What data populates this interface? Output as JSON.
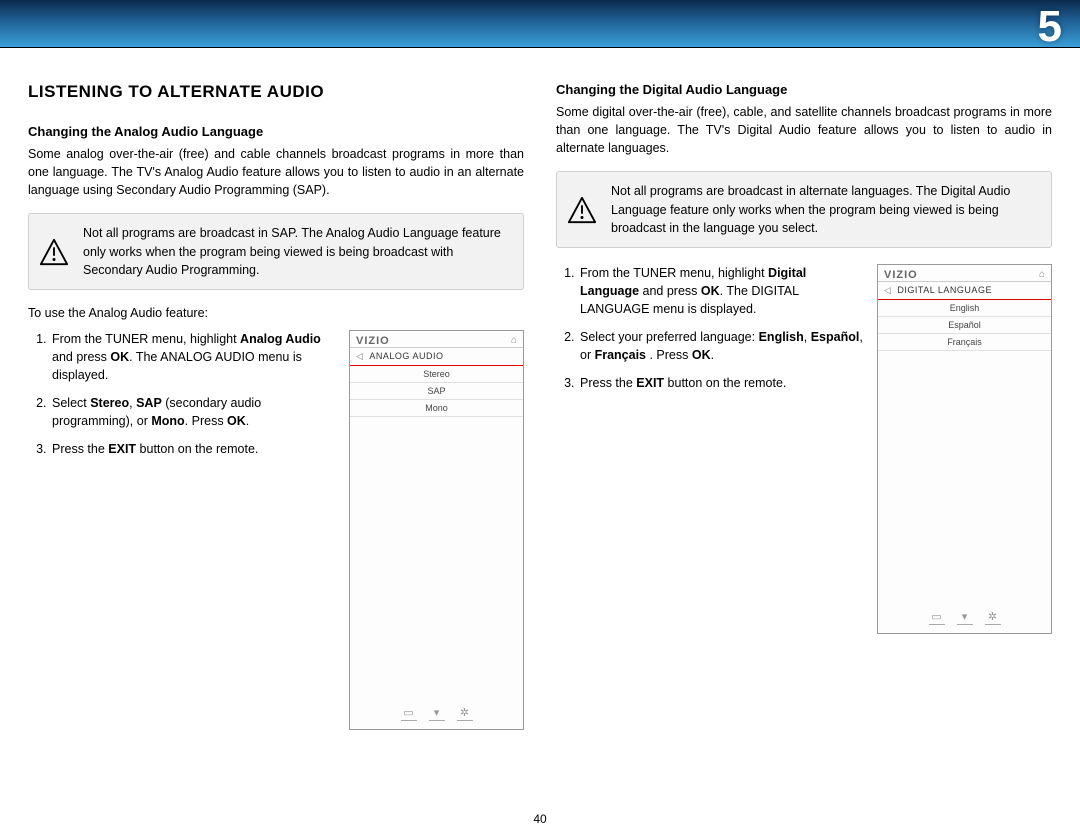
{
  "chapter": "5",
  "pageNumber": "40",
  "col1": {
    "heading": "LISTENING TO ALTERNATE AUDIO",
    "sub": "Changing the Analog Audio Language",
    "intro": "Some analog over-the-air (free) and cable channels broadcast programs in more than one language. The TV's Analog Audio feature allows you to listen to audio in an alternate language using Secondary Audio Programming (SAP).",
    "note": "Not all programs are broadcast in SAP. The Analog Audio Language feature only works when the program being viewed is being broadcast with Secondary Audio Programming.",
    "lead": "To use the Analog Audio feature:",
    "steps": {
      "s1a": "From the TUNER menu, highlight ",
      "s1b": "Analog Audio",
      "s1c": " and press ",
      "s1d": "OK",
      "s1e": ". The ANALOG AUDIO menu is displayed.",
      "s2a": "Select ",
      "s2b": "Stereo",
      "s2c": ", ",
      "s2d": "SAP",
      "s2e": " (secondary audio programming), or ",
      "s2f": "Mono",
      "s2g": ". Press ",
      "s2h": "OK",
      "s2i": ".",
      "s3a": "Press the ",
      "s3b": "EXIT",
      "s3c": " button on the remote."
    },
    "menu": {
      "brand": "VIZIO",
      "title": "ANALOG AUDIO",
      "items": [
        "Stereo",
        "SAP",
        "Mono"
      ]
    }
  },
  "col2": {
    "sub": "Changing the Digital Audio Language",
    "intro": "Some digital over-the-air (free), cable, and satellite channels broadcast programs in more than one language. The TV's Digital Audio feature allows you to listen to audio in alternate languages.",
    "note": "Not all programs are broadcast in alternate languages. The Digital Audio Language feature only works when the program being viewed is being broadcast in the language you select.",
    "steps": {
      "s1a": "From the TUNER menu, highlight ",
      "s1b": "Digital Language",
      "s1c": " and press ",
      "s1d": "OK",
      "s1e": ". The DIGITAL LANGUAGE menu is displayed.",
      "s2a": "Select your preferred language: ",
      "s2b": "English",
      "s2c": ", ",
      "s2d": "Español",
      "s2e": ",  or ",
      "s2f": "Français",
      "s2g": " . Press ",
      "s2h": "OK",
      "s2i": ".",
      "s3a": "Press the ",
      "s3b": "EXIT",
      "s3c": " button on the remote."
    },
    "menu": {
      "brand": "VIZIO",
      "title": "DIGITAL LANGUAGE",
      "items": [
        "English",
        "Español",
        "Français"
      ]
    }
  }
}
